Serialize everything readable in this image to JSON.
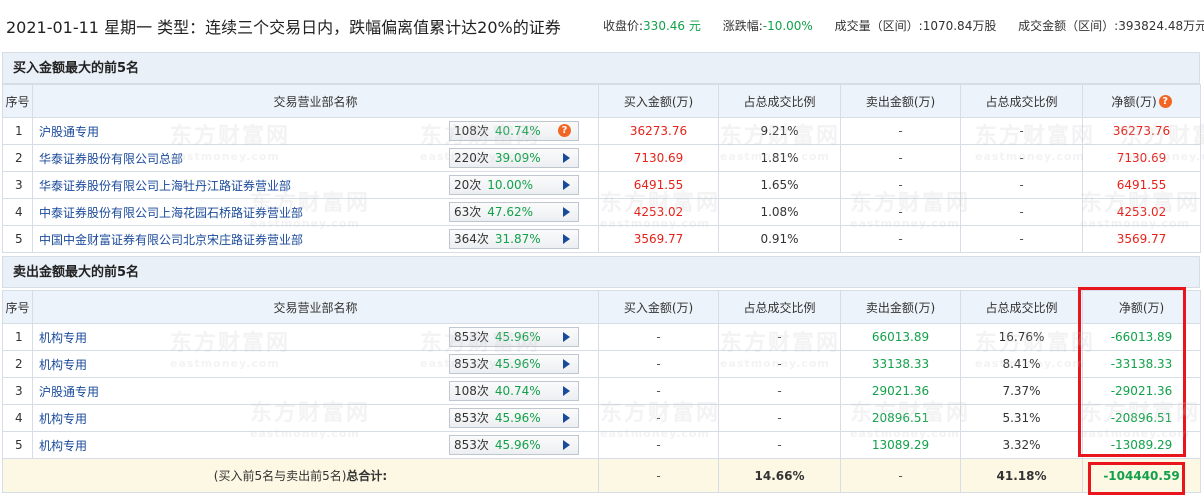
{
  "header": {
    "title": "2021-01-11 星期一 类型：连续三个交易日内，跌幅偏离值累计达20%的证券",
    "close_label": "收盘价:",
    "close_value": "330.46 元",
    "change_label": "涨跌幅:",
    "change_value": "-10.00%",
    "volume_label": "成交量（区间）:",
    "volume_value": "1070.84万股",
    "amount_label": "成交金额（区间）:",
    "amount_value": "393824.48万元"
  },
  "buy_section": {
    "title": "买入金额最大的前5名",
    "columns": [
      "序号",
      "交易营业部名称",
      "买入金额(万)",
      "占总成交比例",
      "卖出金额(万)",
      "占总成交比例",
      "净额(万)"
    ],
    "rows": [
      {
        "idx": "1",
        "name": "沪股通专用",
        "count": "108次",
        "pct": "40.74%",
        "buy": "36273.76",
        "buy_ratio": "9.21%",
        "sell": "-",
        "sell_ratio": "-",
        "net": "36273.76",
        "tag": "?"
      },
      {
        "idx": "2",
        "name": "华泰证券股份有限公司总部",
        "count": "220次",
        "pct": "39.09%",
        "buy": "7130.69",
        "buy_ratio": "1.81%",
        "sell": "-",
        "sell_ratio": "-",
        "net": "7130.69"
      },
      {
        "idx": "3",
        "name": "华泰证券股份有限公司上海牡丹江路证券营业部",
        "count": "20次",
        "pct": "10.00%",
        "buy": "6491.55",
        "buy_ratio": "1.65%",
        "sell": "-",
        "sell_ratio": "-",
        "net": "6491.55"
      },
      {
        "idx": "4",
        "name": "中泰证券股份有限公司上海花园石桥路证券营业部",
        "count": "63次",
        "pct": "47.62%",
        "buy": "4253.02",
        "buy_ratio": "1.08%",
        "sell": "-",
        "sell_ratio": "-",
        "net": "4253.02"
      },
      {
        "idx": "5",
        "name": "中国中金财富证券有限公司北京宋庄路证券营业部",
        "count": "364次",
        "pct": "31.87%",
        "buy": "3569.77",
        "buy_ratio": "0.91%",
        "sell": "-",
        "sell_ratio": "-",
        "net": "3569.77"
      }
    ]
  },
  "sell_section": {
    "title": "卖出金额最大的前5名",
    "columns": [
      "序号",
      "交易营业部名称",
      "买入金额(万)",
      "占总成交比例",
      "卖出金额(万)",
      "占总成交比例",
      "净额(万)"
    ],
    "rows": [
      {
        "idx": "1",
        "name": "机构专用",
        "count": "853次",
        "pct": "45.96%",
        "buy": "-",
        "buy_ratio": "-",
        "sell": "66013.89",
        "sell_ratio": "16.76%",
        "net": "-66013.89"
      },
      {
        "idx": "2",
        "name": "机构专用",
        "count": "853次",
        "pct": "45.96%",
        "buy": "-",
        "buy_ratio": "-",
        "sell": "33138.33",
        "sell_ratio": "8.41%",
        "net": "-33138.33"
      },
      {
        "idx": "3",
        "name": "沪股通专用",
        "count": "108次",
        "pct": "40.74%",
        "buy": "-",
        "buy_ratio": "-",
        "sell": "29021.36",
        "sell_ratio": "7.37%",
        "net": "-29021.36"
      },
      {
        "idx": "4",
        "name": "机构专用",
        "count": "853次",
        "pct": "45.96%",
        "buy": "-",
        "buy_ratio": "-",
        "sell": "20896.51",
        "sell_ratio": "5.31%",
        "net": "-20896.51"
      },
      {
        "idx": "5",
        "name": "机构专用",
        "count": "853次",
        "pct": "45.96%",
        "buy": "-",
        "buy_ratio": "-",
        "sell": "13089.29",
        "sell_ratio": "3.32%",
        "net": "-13089.29"
      }
    ],
    "total": {
      "label_prefix": "(买入前5名与卖出前5名)",
      "label_bold": "总合计:",
      "buy": "-",
      "buy_ratio": "14.66%",
      "sell": "-",
      "sell_ratio": "41.18%",
      "net": "-104440.59"
    }
  },
  "watermark": {
    "cn": "东方财富网",
    "en": "eastmoney.com"
  },
  "colors": {
    "red": "#e5231b",
    "green": "#12a14a",
    "highlight": "#e8161c",
    "header_bg": "#edf3fa"
  }
}
